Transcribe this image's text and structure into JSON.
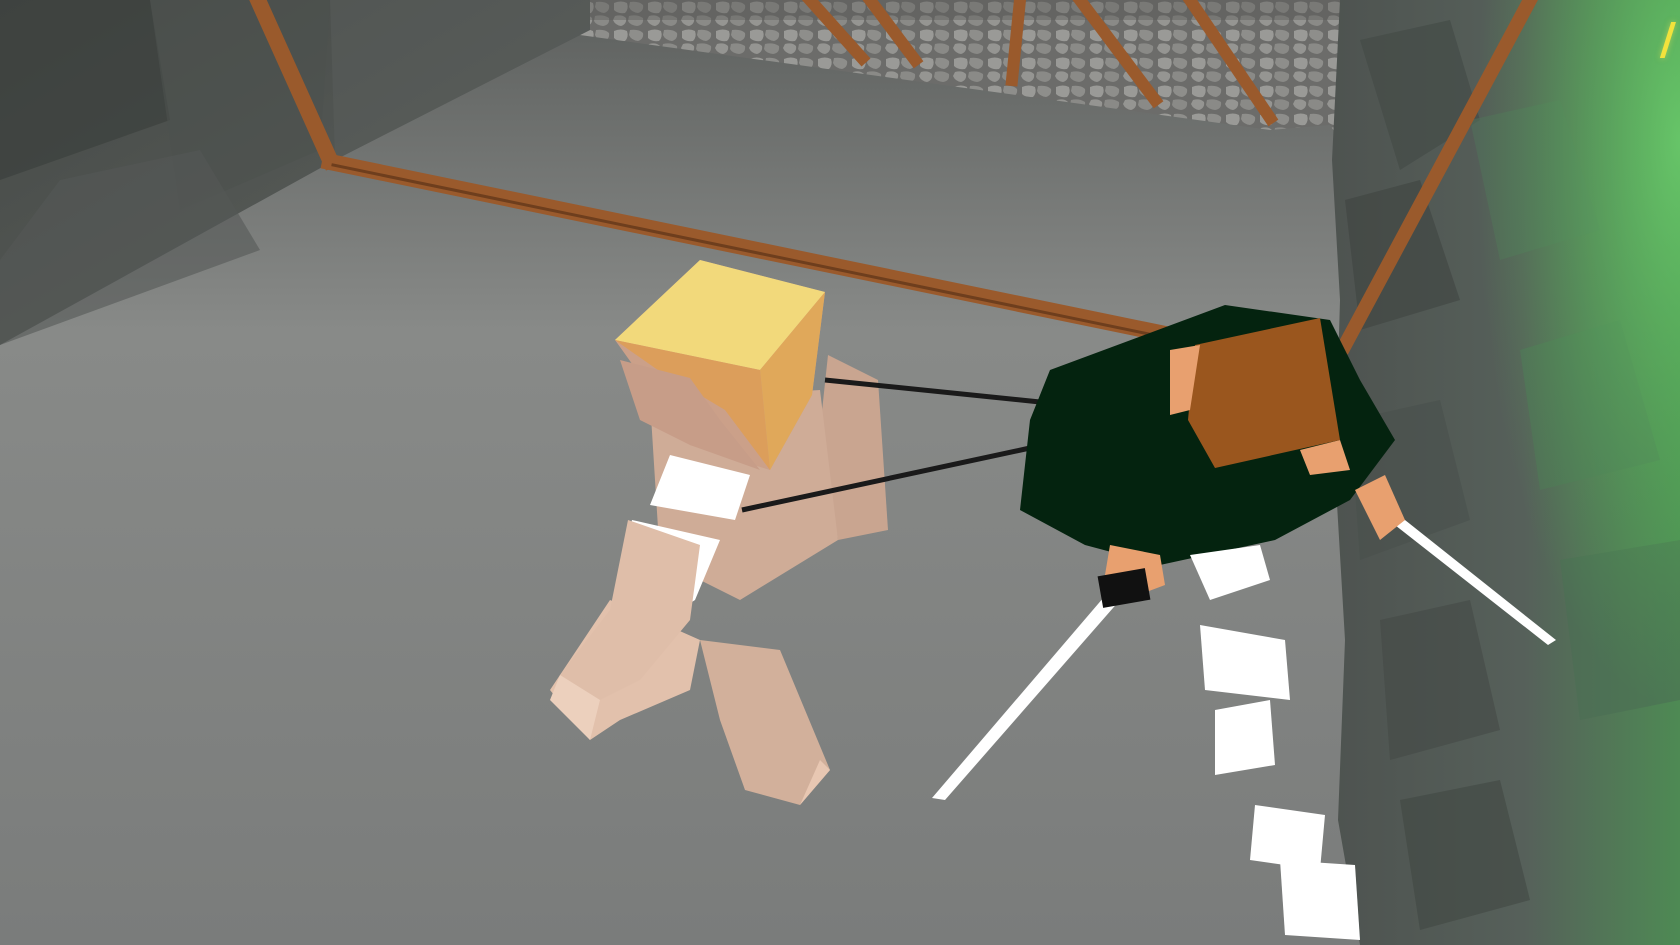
{
  "scene": {
    "view": "third-person-overhead",
    "environment": "stone-walled-room",
    "lighting_glow": "#4fbf4f"
  },
  "hud": {
    "corner_text": "/"
  },
  "colors": {
    "floor": "#7d7f7d",
    "wall": "#4a4e4b",
    "beam": "#9a5a2c",
    "cobble": "#8a8a88",
    "titan_skin": "#d8b8a3",
    "titan_hair": "#f2d97b",
    "player_cloak": "#04230f",
    "player_hair": "#9a561e",
    "blade": "#ffffff",
    "gear_wire": "#1a1a1a"
  },
  "entities": [
    {
      "name": "titan-enemy",
      "hair": "blonde",
      "state": "walking"
    },
    {
      "name": "player-character",
      "equipment": "odm-gear",
      "weapon": "dual-blades"
    }
  ]
}
